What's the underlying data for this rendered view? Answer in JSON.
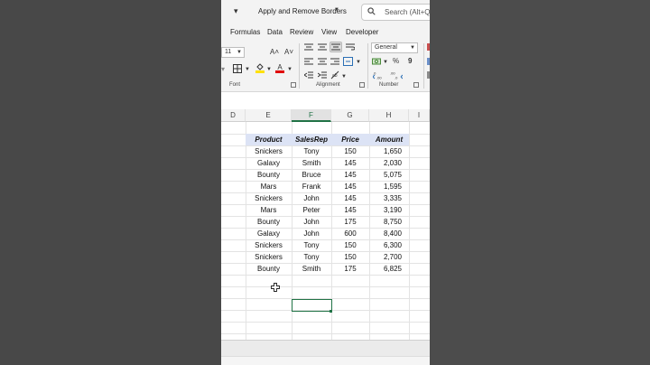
{
  "window": {
    "title": "Apply and Remove Borders",
    "search_placeholder": "Search (Alt+Q)"
  },
  "ribbon_tabs": [
    "Formulas",
    "Data",
    "Review",
    "View",
    "Developer"
  ],
  "ribbon": {
    "font_size": "11",
    "grow_font_label": "A˄",
    "shrink_font_label": "A˅",
    "number_format": "General",
    "percent_label": "%",
    "comma_label": "9",
    "groups": {
      "font": "Font",
      "alignment": "Alignment",
      "number": "Number"
    },
    "colors": {
      "highlight": "#ffe100",
      "font_color": "#e00000",
      "accent": "#217346"
    }
  },
  "columns": [
    "D",
    "E",
    "F",
    "G",
    "H",
    "I"
  ],
  "selected_column": "F",
  "table": {
    "headers": [
      "Product",
      "SalesRep",
      "Price",
      "Amount"
    ],
    "rows": [
      [
        "Snickers",
        "Tony",
        "150",
        "1,650"
      ],
      [
        "Galaxy",
        "Smith",
        "145",
        "2,030"
      ],
      [
        "Bounty",
        "Bruce",
        "145",
        "5,075"
      ],
      [
        "Mars",
        "Frank",
        "145",
        "1,595"
      ],
      [
        "Snickers",
        "John",
        "145",
        "3,335"
      ],
      [
        "Mars",
        "Peter",
        "145",
        "3,190"
      ],
      [
        "Bounty",
        "John",
        "175",
        "8,750"
      ],
      [
        "Galaxy",
        "John",
        "600",
        "8,400"
      ],
      [
        "Snickers",
        "Tony",
        "150",
        "6,300"
      ],
      [
        "Snickers",
        "Tony",
        "150",
        "2,700"
      ],
      [
        "Bounty",
        "Smith",
        "175",
        "6,825"
      ]
    ]
  }
}
